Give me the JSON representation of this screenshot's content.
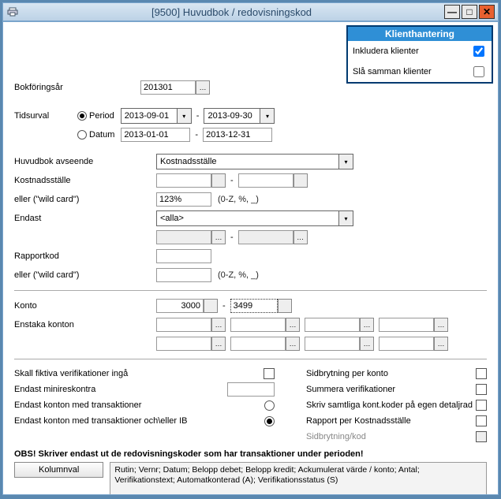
{
  "window": {
    "title": "[9500]   Huvudbok / redovisningskod"
  },
  "klient": {
    "header": "Klienthantering",
    "inkludera": "Inkludera klienter",
    "sla": "Slå samman klienter"
  },
  "labels": {
    "bokforingsar": "Bokföringsår",
    "tidsurval": "Tidsurval",
    "period": "Period",
    "datum": "Datum",
    "huvudbok_avseende": "Huvudbok avseende",
    "kostnadsstalle": "Kostnadsställe",
    "eller_wild": "eller (\"wild card\")",
    "endast": "Endast",
    "rapportkod": "Rapportkod",
    "konto": "Konto",
    "enstaka_konton": "Enstaka konton"
  },
  "values": {
    "bokforingsar": "201301",
    "period_from": "2013-09-01",
    "period_to": "2013-09-30",
    "datum_from": "2013-01-01",
    "datum_to": "2013-12-31",
    "huvudbok_sel": "Kostnadsställe",
    "kostnad_from": "",
    "kostnad_to": "",
    "wild1": "123%",
    "hint_wild": "(0-Z, %, _)",
    "endast_sel": "<alla>",
    "gray_from": "",
    "gray_to": "",
    "rapportkod": "",
    "wild2": "",
    "konto_from": "3000",
    "konto_to": "3499",
    "enstaka": [
      "",
      "",
      "",
      "",
      "",
      "",
      "",
      ""
    ]
  },
  "options_left": {
    "fiktiva": "Skall fiktiva verifikationer ingå",
    "minireskontra": "Endast minireskontra",
    "trans": "Endast konton med transaktioner",
    "trans_ib": "Endast konton med transaktioner och\\eller IB"
  },
  "options_right": {
    "sidbryt_konto": "Sidbrytning per konto",
    "summera": "Summera verifikationer",
    "skriv": "Skriv samtliga kont.koder på egen detaljrad",
    "rapport": "Rapport per Kostnadsställe",
    "sidbryt_kod": "Sidbrytning/kod"
  },
  "footer": {
    "obs": "OBS! Skriver endast ut de redovisningskoder som har transaktioner under perioden!",
    "kolumnval": "Kolumnval",
    "kolumn_desc": "Rutin; Vernr; Datum; Belopp debet; Belopp kredit; Ackumulerat värde / konto; Antal; Verifikationstext; Automatkonterad (A); Verifikationsstatus (S)"
  }
}
